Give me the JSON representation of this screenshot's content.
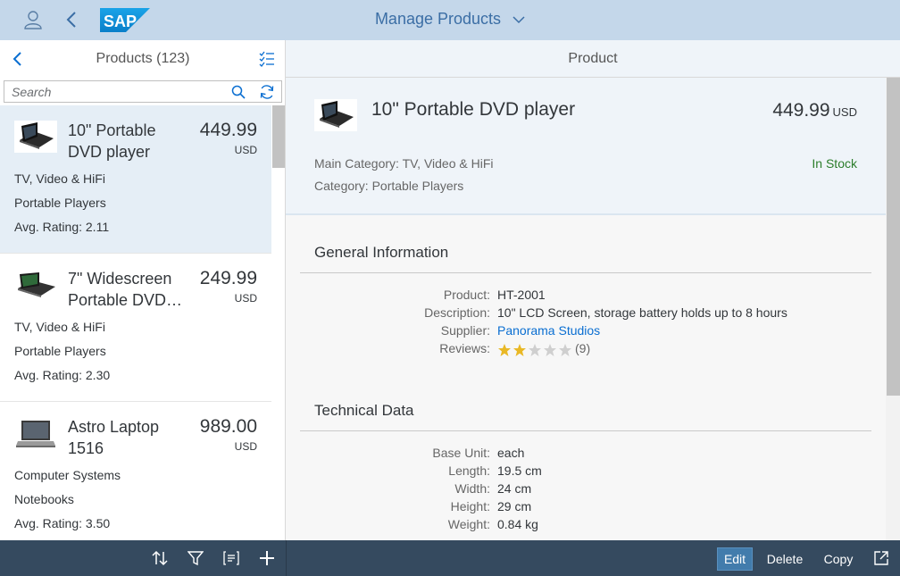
{
  "shell": {
    "logo_text": "SAP",
    "title": "Manage Products"
  },
  "master": {
    "title": "Products (123)",
    "search_placeholder": "Search",
    "items": [
      {
        "name": "10\" Portable DVD player",
        "price": "449.99",
        "currency": "USD",
        "category": "TV, Video & HiFi",
        "subcategory": "Portable Players",
        "rating": "Avg. Rating: 2.11",
        "selected": true
      },
      {
        "name": "7\" Widescreen Portable DVD…",
        "price": "249.99",
        "currency": "USD",
        "category": "TV, Video & HiFi",
        "subcategory": "Portable Players",
        "rating": "Avg. Rating: 2.30",
        "selected": false
      },
      {
        "name": "Astro Laptop 1516",
        "price": "989.00",
        "currency": "USD",
        "category": "Computer Systems",
        "subcategory": "Notebooks",
        "rating": "Avg. Rating: 3.50",
        "selected": false
      }
    ]
  },
  "detail": {
    "header_title": "Product",
    "object": {
      "title": "10\" Portable DVD player",
      "price": "449.99",
      "currency": "USD",
      "main_category": "Main Category: TV, Video & HiFi",
      "category": "Category: Portable Players",
      "status": "In Stock"
    },
    "general": {
      "title": "General Information",
      "product_label": "Product:",
      "product_value": "HT-2001",
      "description_label": "Description:",
      "description_value": "10\" LCD Screen, storage battery holds up to 8 hours",
      "supplier_label": "Supplier:",
      "supplier_value": "Panorama Studios",
      "reviews_label": "Reviews:",
      "reviews_count": "(9)",
      "rating_stars": 2,
      "rating_max": 5
    },
    "technical": {
      "title": "Technical Data",
      "base_unit_label": "Base Unit:",
      "base_unit_value": "each",
      "length_label": "Length:",
      "length_value": "19.5 cm",
      "width_label": "Width:",
      "width_value": "24 cm",
      "height_label": "Height:",
      "height_value": "29 cm",
      "weight_label": "Weight:",
      "weight_value": "0.84 kg"
    }
  },
  "footer": {
    "master_icons": [
      "sort-icon",
      "filter-icon",
      "group-icon",
      "add-icon"
    ],
    "edit_label": "Edit",
    "delete_label": "Delete",
    "copy_label": "Copy",
    "share_icon": "share-icon"
  },
  "colors": {
    "shell_bg": "#c4d7ea",
    "footer_bg": "#354a5f",
    "accent": "#0a6ed1",
    "status_success": "#2b7d2b",
    "star_filled": "#e9b825",
    "star_empty": "#cfcfcf"
  }
}
